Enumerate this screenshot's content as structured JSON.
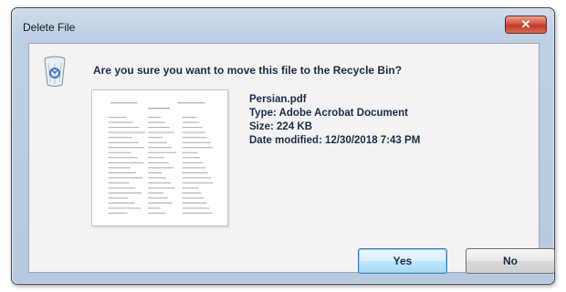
{
  "window": {
    "title": "Delete File",
    "close_glyph": "✕"
  },
  "dialog": {
    "question": "Are you sure you want to move this file to the Recycle Bin?",
    "icon": "recycle-bin-icon",
    "file": {
      "name": "Persian.pdf",
      "type": "Type: Adobe Acrobat Document",
      "size": "Size: 224 KB",
      "modified": "Date modified: 12/30/2018 7:43 PM"
    },
    "buttons": {
      "yes": "Yes",
      "no": "No"
    }
  },
  "colors": {
    "close_button": "#c23a24",
    "default_button_border": "#3c7fb1",
    "titlebar": "#bed0e4"
  }
}
